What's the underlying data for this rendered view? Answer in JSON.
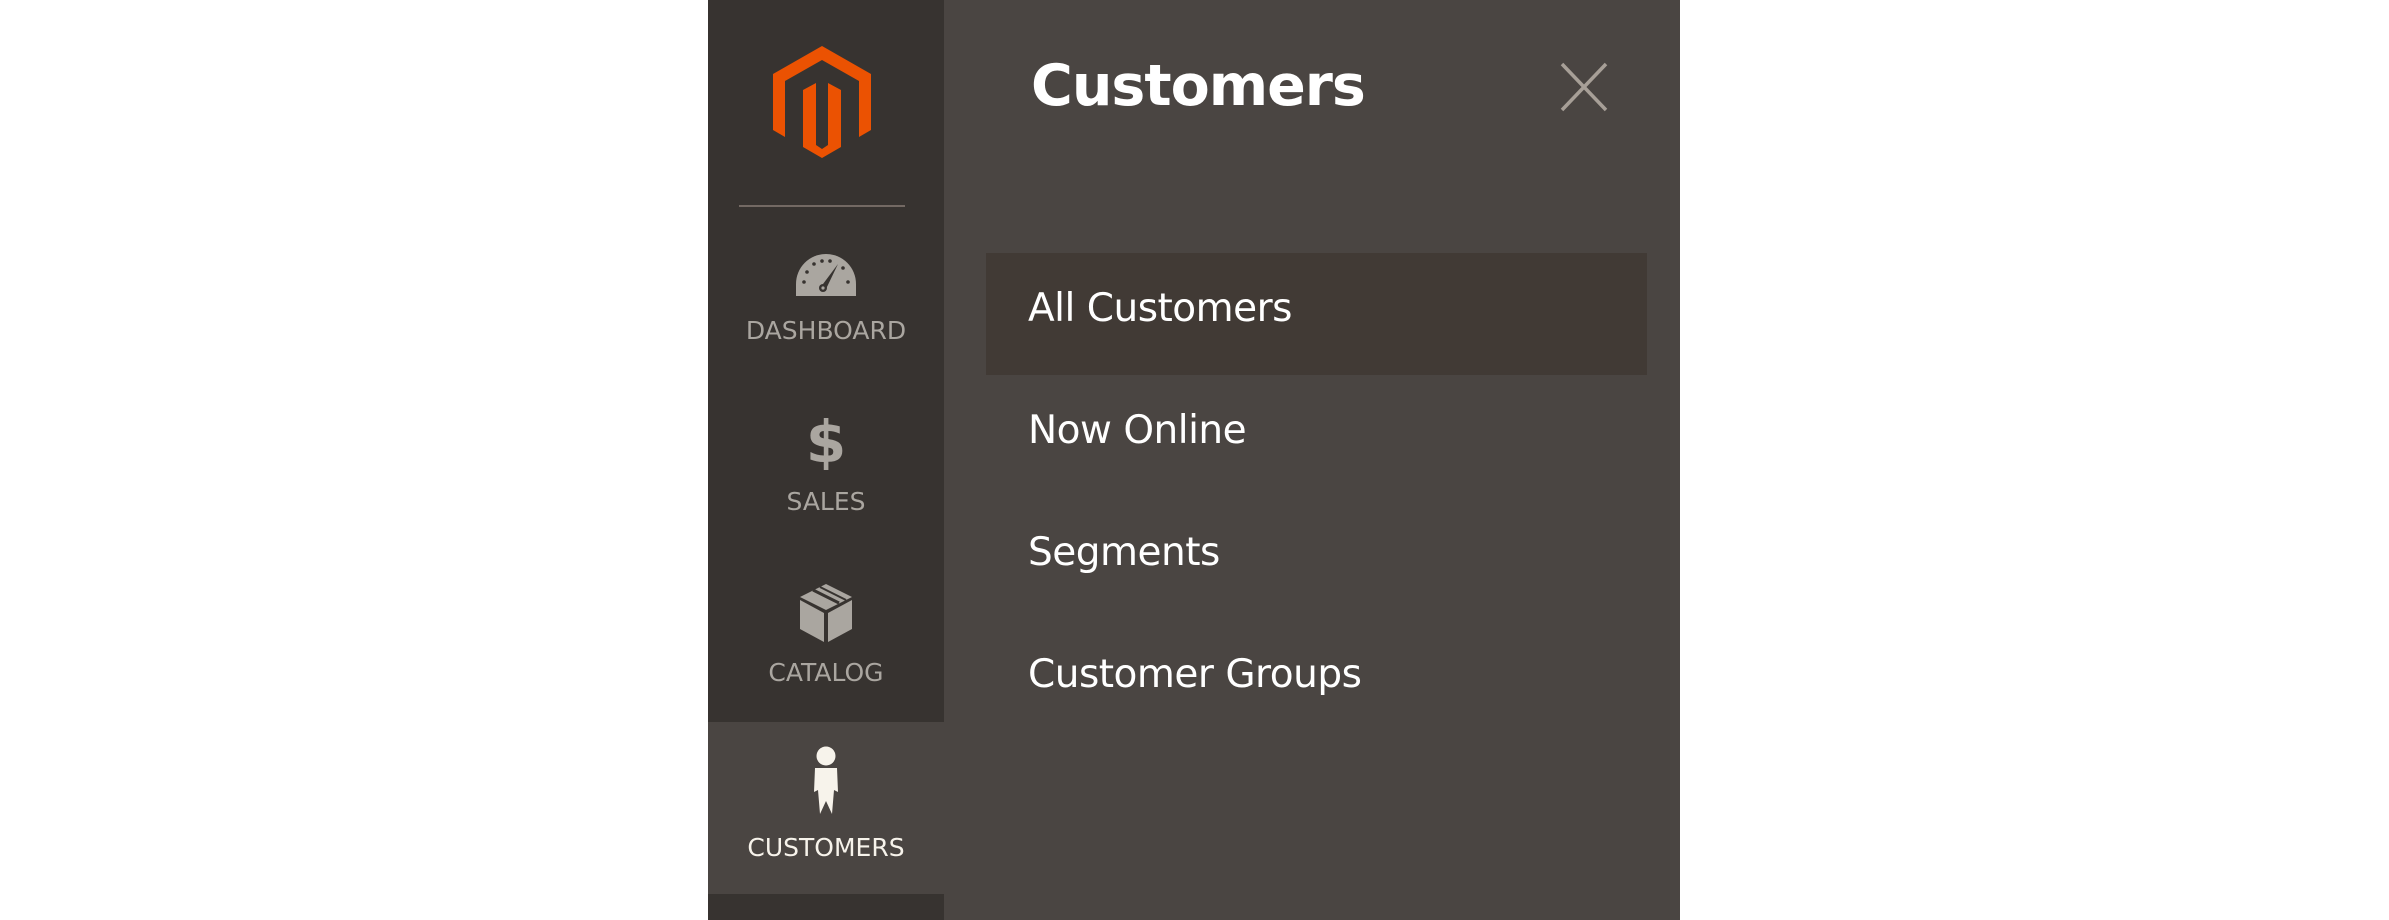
{
  "sidebar": {
    "logo_icon": "magento-logo-icon",
    "items": [
      {
        "label": "DASHBOARD",
        "icon": "dashboard-gauge-icon",
        "active": false
      },
      {
        "label": "SALES",
        "icon": "dollar-icon",
        "active": false
      },
      {
        "label": "CATALOG",
        "icon": "box-icon",
        "active": false
      },
      {
        "label": "CUSTOMERS",
        "icon": "person-icon",
        "active": true
      }
    ]
  },
  "panel": {
    "title": "Customers",
    "close_icon": "close-icon",
    "items": [
      {
        "label": "All Customers",
        "active": true
      },
      {
        "label": "Now Online",
        "active": false
      },
      {
        "label": "Segments",
        "active": false
      },
      {
        "label": "Customer Groups",
        "active": false
      }
    ]
  },
  "colors": {
    "brand_orange": "#eb5202",
    "sidebar_bg": "#373330",
    "panel_bg": "#4a4542",
    "submenu_active_bg": "#413a35",
    "nav_label": "#aaa6a0",
    "nav_label_active": "#f7f3eb",
    "close_icon": "#a79f97"
  }
}
